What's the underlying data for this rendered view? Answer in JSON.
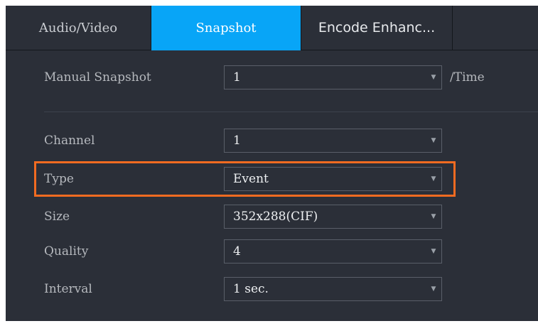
{
  "tabs": [
    {
      "label": "Audio/Video",
      "active": false
    },
    {
      "label": "Snapshot",
      "active": true
    },
    {
      "label": "Encode Enhanc...",
      "active": false
    }
  ],
  "manual_snapshot": {
    "label": "Manual Snapshot",
    "value": "1",
    "suffix": "/Time"
  },
  "fields": {
    "channel": {
      "label": "Channel",
      "value": "1"
    },
    "type": {
      "label": "Type",
      "value": "Event"
    },
    "size": {
      "label": "Size",
      "value": "352x288(CIF)"
    },
    "quality": {
      "label": "Quality",
      "value": "4"
    },
    "interval": {
      "label": "Interval",
      "value": "1 sec."
    }
  },
  "colors": {
    "background": "#2b2f38",
    "active_tab": "#08a5f7",
    "highlight": "#f26b21"
  },
  "icons": {
    "dropdown_arrow": "▼"
  }
}
